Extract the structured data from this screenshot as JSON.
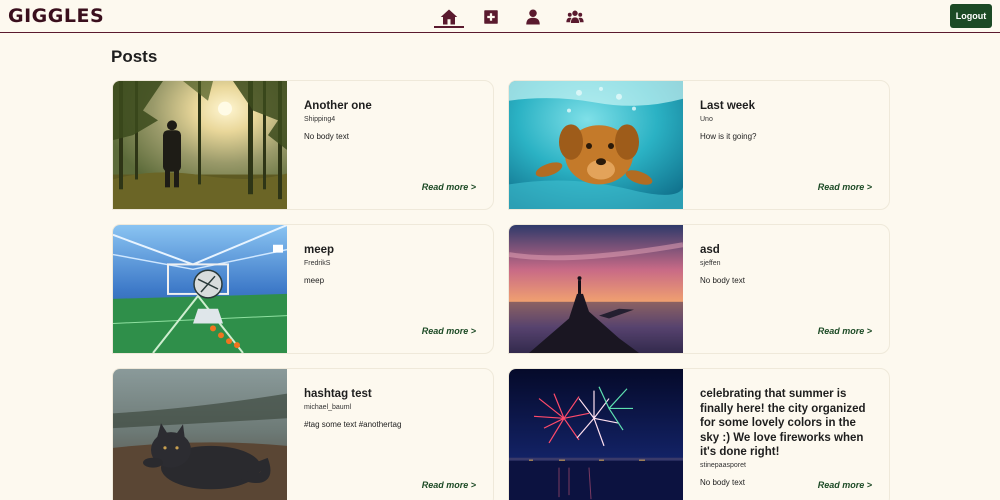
{
  "header": {
    "logo_text": "GIGGLES",
    "nav": [
      {
        "icon": "home-icon",
        "active": true
      },
      {
        "icon": "add-post-icon",
        "active": false
      },
      {
        "icon": "user-icon",
        "active": false
      },
      {
        "icon": "group-icon",
        "active": false
      }
    ],
    "logout_label": "Logout"
  },
  "page": {
    "title": "Posts"
  },
  "posts": [
    {
      "title": "Another one",
      "author": "Shipping4",
      "body": "No body text",
      "read_more": "Read more >",
      "image": "forest-sunset-person"
    },
    {
      "title": "Last week",
      "author": "Uno",
      "body": "How is it going?",
      "read_more": "Read more >",
      "image": "dog-underwater"
    },
    {
      "title": "meep",
      "author": "FredrikS",
      "body": "meep",
      "read_more": "Read more >",
      "image": "rocket-league-game"
    },
    {
      "title": "asd",
      "author": "sjeffen",
      "body": "No body text",
      "read_more": "Read more >",
      "image": "cliff-sunset-person"
    },
    {
      "title": "hashtag test",
      "author": "michael_bauml",
      "body": "#tag some text #anothertag",
      "read_more": "Read more >",
      "image": "arctic-fox"
    },
    {
      "title": "celebrating that summer is finally here! the city organized for some lovely colors in the sky :) We love fireworks when it's done right!",
      "author": "stinepaasporet",
      "body": "No body text",
      "read_more": "Read more >",
      "image": "fireworks-night"
    }
  ]
}
